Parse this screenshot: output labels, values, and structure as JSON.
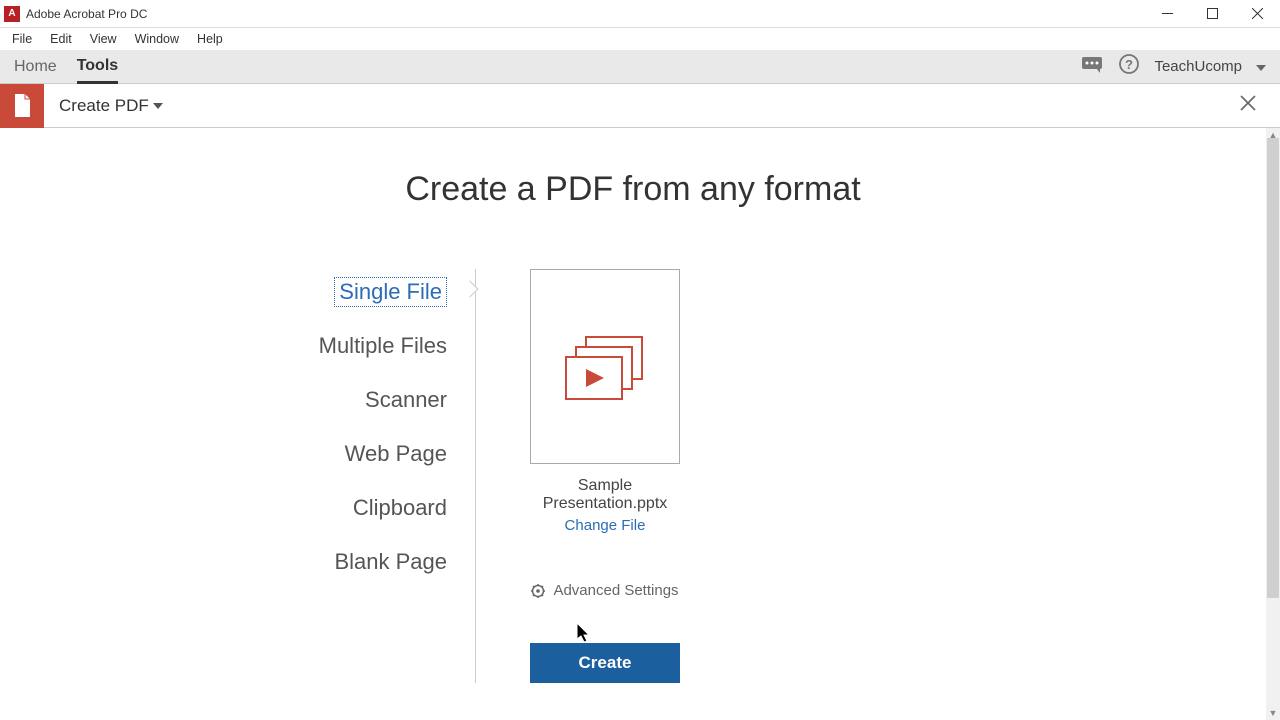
{
  "title": "Adobe Acrobat Pro DC",
  "menubar": [
    "File",
    "Edit",
    "View",
    "Window",
    "Help"
  ],
  "tabs": {
    "home": "Home",
    "tools": "Tools"
  },
  "account": {
    "user": "TeachUcomp"
  },
  "toolbar": {
    "label": "Create PDF"
  },
  "main": {
    "heading": "Create a PDF from any format",
    "options": [
      "Single File",
      "Multiple Files",
      "Scanner",
      "Web Page",
      "Clipboard",
      "Blank Page"
    ],
    "selected_file": "Sample Presentation.pptx",
    "change_file": "Change File",
    "advanced": "Advanced Settings",
    "create": "Create"
  }
}
